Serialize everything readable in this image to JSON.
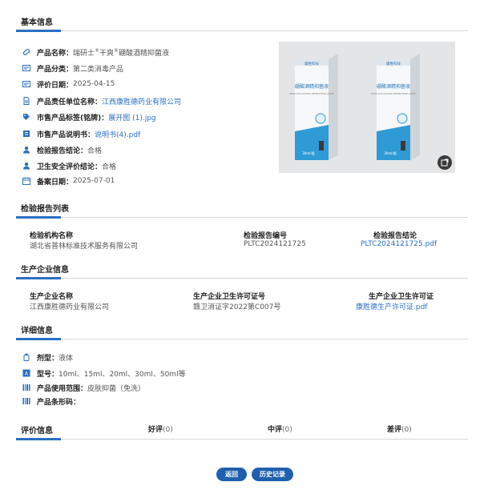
{
  "basic": {
    "title": "基本信息",
    "name_label": "产品名称：",
    "name_value": "瑞研士",
    "name_reg1": "®",
    "name_mid": "干爽",
    "name_reg2": "®",
    "name_tail": "硼酸酒精抑菌液",
    "category_label": "产品分类：",
    "category_value": "第二类消毒产品",
    "eval_date_label": "评价日期：",
    "eval_date_value": "2025-04-15",
    "responsible_label": "产品责任单位名称：",
    "responsible_value": "江西康胜德药业有限公司",
    "tag_label": "市售产品标签(铭牌)：",
    "tag_value": "展开图 (1).jpg",
    "manual_label": "市售产品说明书：",
    "manual_value": "说明书(4).pdf",
    "report_conclusion_label": "检验报告结论：",
    "report_conclusion_value": "合格",
    "safety_label": "卫生安全评价结论：",
    "safety_value": "合格",
    "filing_date_label": "备案日期：",
    "filing_date_value": "2025-07-01"
  },
  "product_image": {
    "box_brand": "康胜科技",
    "box_name": "硼酸酒精抑菌液",
    "box_en": "BORIC ACID ALCOHOL ANTIBACTERIAL LIQUID",
    "box_volume": "30ml/瓶",
    "accent": "#2f9bd6"
  },
  "reports": {
    "title": "检验报告列表",
    "h_org": "检验机构名称",
    "h_no": "检验报告编号",
    "h_conclusion": "检验报告结论",
    "org": "湖北省普林标准技术服务有限公司",
    "no": "PLTC2024121725",
    "file": "PLTC2024121725.pdf"
  },
  "company": {
    "title": "生产企业信息",
    "h_name": "生产企业名称",
    "h_license_no": "生产企业卫生许可证号",
    "h_license": "生产企业卫生许可证",
    "name": "江西康胜德药业有限公司",
    "license_no": "赣卫消证字2022第C007号",
    "license_file": "康胜德生产许可证.pdf"
  },
  "detail": {
    "title": "详细信息",
    "form_label": "剂型：",
    "form_value": "液体",
    "model_label": "型号：",
    "model_value": "10ml、15ml、20ml、30ml、50ml等",
    "scope_label": "产品使用范围：",
    "scope_value": "皮肤抑菌（免洗）",
    "barcode_label": "产品条形码："
  },
  "rating": {
    "title": "评价信息",
    "good_label": "好评",
    "good_count": "(0)",
    "mid_label": "中评",
    "mid_count": "(0)",
    "bad_label": "差评",
    "bad_count": "(0)"
  },
  "buttons": {
    "back": "返回",
    "history": "历史记录"
  },
  "colors": {
    "accent": "#2a6fc4",
    "button": "#1e5fae"
  }
}
